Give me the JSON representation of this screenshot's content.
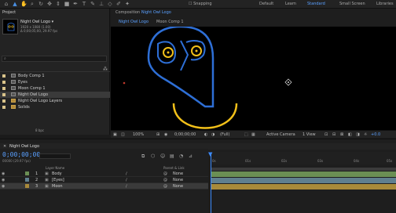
{
  "toolbar": {
    "snapping_label": "Snapping",
    "workspaces": [
      "Default",
      "Learn",
      "Standard",
      "Small Screen",
      "Libraries"
    ],
    "active_workspace": "Standard"
  },
  "project": {
    "tab_label": "Project",
    "comp_name": "Night Owl Logo ▾",
    "comp_info_1": "1920 x 1080 (1.00)",
    "comp_info_2": "Δ 0;00;05;00, 29.97 fps",
    "search_placeholder": "⌕",
    "items": [
      {
        "label": "Body Comp 1",
        "type": "comp"
      },
      {
        "label": "Eyes",
        "type": "comp"
      },
      {
        "label": "Moon Comp 1",
        "type": "comp"
      },
      {
        "label": "Night Owl Logo",
        "type": "comp",
        "selected": true
      },
      {
        "label": "Night Owl Logo Layers",
        "type": "folder"
      },
      {
        "label": "Solids",
        "type": "folder"
      }
    ],
    "bpc": "8 bpc"
  },
  "composition": {
    "title_prefix": "Composition",
    "title_name": "Night Owl Logo",
    "tabs": [
      "Night Owl Logo",
      "Moon Comp 1"
    ],
    "zoom": "100%",
    "timecode": "0;00;00;00",
    "resolution": "(Full)",
    "camera": "Active Camera",
    "views": "1 View",
    "exposure": "+0.0"
  },
  "timeline": {
    "tab_label": "Night Owl Logo",
    "timecode": "0;00;00;00",
    "sub_timecode": "00000 (29.97 fps)",
    "columns": [
      "Layer Name",
      "Parent & Link"
    ],
    "ruler_labels": [
      "0s",
      "01s",
      "02s",
      "03s",
      "04s",
      "05s"
    ],
    "layers": [
      {
        "num": "1",
        "name": "Body",
        "parent": "None",
        "color": "#6b8f54"
      },
      {
        "num": "2",
        "name": "[Eyes]",
        "parent": "None",
        "color": "#5f7f8f"
      },
      {
        "num": "3",
        "name": "Moon",
        "parent": "None",
        "color": "#a88a3a",
        "selected": true
      }
    ]
  },
  "colors": {
    "owl_blue": "#2e6fd6",
    "owl_yellow": "#f2c019",
    "accent": "#5aa0ff"
  }
}
